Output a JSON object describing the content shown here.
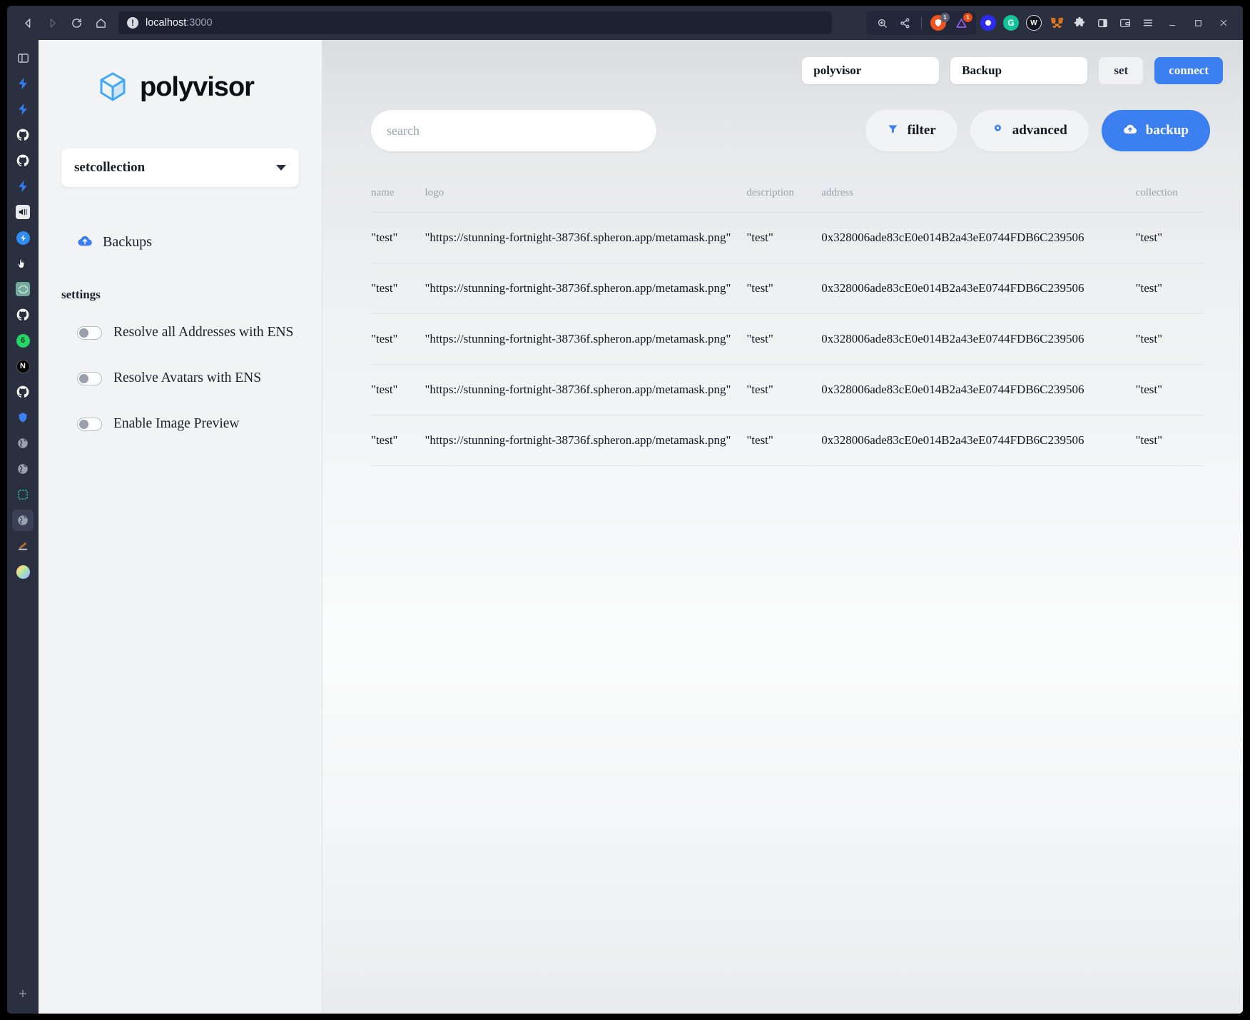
{
  "browser": {
    "nav": {
      "back_icon": "back-arrow-icon",
      "forward_icon": "forward-arrow-icon",
      "reload_icon": "reload-icon",
      "home_icon": "home-icon"
    },
    "url": {
      "host": "localhost",
      "port": ":3000",
      "security_glyph": "!"
    },
    "toolbar": {
      "zoom_icon": "zoom-in-icon",
      "share_icon": "share-icon",
      "shield_badge": "1",
      "rewards_badge": "1",
      "extensions": [
        {
          "name": "brave-shields-icon",
          "glyph": "",
          "color": "#f0551f",
          "badge": "1"
        },
        {
          "name": "brave-rewards-icon",
          "glyph": "",
          "color": "#7b2ff7",
          "badge": "1"
        },
        {
          "name": "wallet-blue-icon",
          "glyph": "",
          "color": "#2b2bf5"
        },
        {
          "name": "grammarly-icon",
          "glyph": "G",
          "color": "#15c39a"
        },
        {
          "name": "walletconnect-icon",
          "glyph": "W",
          "color": "#111318"
        },
        {
          "name": "metamask-icon",
          "glyph": "",
          "color": "#e2761b"
        },
        {
          "name": "puzzle-extensions-icon",
          "glyph": "",
          "color": "#d7dae2"
        },
        {
          "name": "sidebar-toggle-icon",
          "glyph": "",
          "color": "#d7dae2"
        },
        {
          "name": "brave-wallet-icon",
          "glyph": "",
          "color": "#d7dae2"
        }
      ],
      "menu_icon": "hamburger-menu-icon",
      "minimize_icon": "minimize-icon",
      "maximize_icon": "maximize-icon",
      "close_icon": "close-icon"
    },
    "vertical_tabs": [
      {
        "name": "tab-panel-toggle",
        "type": "panel",
        "color": "#c4c9d6"
      },
      {
        "name": "tab-supabase-1",
        "type": "bolt",
        "color": "#2f7ef0"
      },
      {
        "name": "tab-supabase-2",
        "type": "bolt",
        "color": "#2f7ef0"
      },
      {
        "name": "tab-github-1",
        "type": "github",
        "color": "#ffffff"
      },
      {
        "name": "tab-github-2",
        "type": "github",
        "color": "#ffffff"
      },
      {
        "name": "tab-supabase-3",
        "type": "bolt",
        "color": "#2f7ef0"
      },
      {
        "name": "tab-media-player",
        "type": "media",
        "color": "#e8eaf0"
      },
      {
        "name": "tab-flash-blue",
        "type": "flash",
        "color": "#2f8ef0"
      },
      {
        "name": "tab-hand-cursor",
        "type": "hand",
        "color": "#ffffff"
      },
      {
        "name": "tab-openai",
        "type": "openai",
        "color": "#74aa9c"
      },
      {
        "name": "tab-github-3",
        "type": "github",
        "color": "#ffffff"
      },
      {
        "name": "tab-whatsapp",
        "type": "chat",
        "color": "#25d366",
        "badge": "6"
      },
      {
        "name": "tab-nextjs",
        "type": "next",
        "color": "#000000"
      },
      {
        "name": "tab-github-4",
        "type": "github",
        "color": "#ffffff"
      },
      {
        "name": "tab-shield-blue",
        "type": "shield",
        "color": "#3b82f6"
      },
      {
        "name": "tab-globe-1",
        "type": "globe",
        "color": "#9aa0ad"
      },
      {
        "name": "tab-globe-2",
        "type": "globe",
        "color": "#9aa0ad"
      },
      {
        "name": "tab-selection",
        "type": "selection",
        "color": "#2dd4a7"
      },
      {
        "name": "tab-globe-active",
        "type": "globe",
        "color": "#9aa0ad",
        "active": true
      },
      {
        "name": "tab-books",
        "type": "books",
        "color": "#d98b3a"
      },
      {
        "name": "tab-colorwheel",
        "type": "wheel",
        "color": "#d0d4dd"
      }
    ],
    "new_tab_label": "+"
  },
  "sidebar": {
    "logo": {
      "icon_name": "polyvisor-cube-icon",
      "wordmark": "polyvisor",
      "color": "#3fa9f5"
    },
    "collection_select": {
      "value": "setcollection",
      "caret_icon": "chevron-down-icon"
    },
    "nav": [
      {
        "label": "Backups",
        "icon": "cloud-upload-icon",
        "icon_color": "#3b7ff0"
      }
    ],
    "settings_heading": "settings",
    "toggles": [
      {
        "label": "Resolve all Addresses with ENS",
        "on": false
      },
      {
        "label": "Resolve Avatars with ENS",
        "on": false
      },
      {
        "label": "Enable Image Preview",
        "on": false
      }
    ]
  },
  "topbar": {
    "project_input": "polyvisor",
    "mode_input": "Backup",
    "set_label": "set",
    "connect_label": "connect"
  },
  "actionbar": {
    "search_placeholder": "search",
    "search_value": "",
    "filter_label": "filter",
    "filter_icon": "funnel-icon",
    "advanced_label": "advanced",
    "advanced_icon": "gear-icon",
    "backup_label": "backup",
    "backup_icon": "cloud-upload-icon"
  },
  "table": {
    "columns": [
      "name",
      "logo",
      "description",
      "address",
      "collection"
    ],
    "rows": [
      {
        "name": "\"test\"",
        "logo": "\"https://stunning-fortnight-38736f.spheron.app/metamask.png\"",
        "description": "\"test\"",
        "address": "0x328006ade83cE0e014B2a43eE0744FDB6C239506",
        "collection": "\"test\""
      },
      {
        "name": "\"test\"",
        "logo": "\"https://stunning-fortnight-38736f.spheron.app/metamask.png\"",
        "description": "\"test\"",
        "address": "0x328006ade83cE0e014B2a43eE0744FDB6C239506",
        "collection": "\"test\""
      },
      {
        "name": "\"test\"",
        "logo": "\"https://stunning-fortnight-38736f.spheron.app/metamask.png\"",
        "description": "\"test\"",
        "address": "0x328006ade83cE0e014B2a43eE0744FDB6C239506",
        "collection": "\"test\""
      },
      {
        "name": "\"test\"",
        "logo": "\"https://stunning-fortnight-38736f.spheron.app/metamask.png\"",
        "description": "\"test\"",
        "address": "0x328006ade83cE0e014B2a43eE0744FDB6C239506",
        "collection": "\"test\""
      },
      {
        "name": "\"test\"",
        "logo": "\"https://stunning-fortnight-38736f.spheron.app/metamask.png\"",
        "description": "\"test\"",
        "address": "0x328006ade83cE0e014B2a43eE0744FDB6C239506",
        "collection": "\"test\""
      }
    ]
  },
  "colors": {
    "accent": "#3b7ff0",
    "chrome_bg": "#2b3040",
    "logo_blue": "#3fa9f5"
  }
}
